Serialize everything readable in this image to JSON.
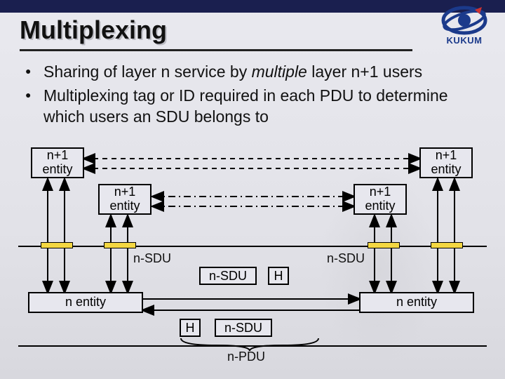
{
  "header": {
    "title": "Multiplexing",
    "logo_text": "KUKUM"
  },
  "bullets": [
    "Sharing of layer n service by multiple layer n+1 users",
    "Multiplexing tag or ID required in each PDU to determine which users an SDU belongs to"
  ],
  "diagram": {
    "entities": {
      "upper_left_1": "n+1\nentity",
      "upper_left_2": "n+1\nentity",
      "upper_right_1": "n+1\nentity",
      "upper_right_2": "n+1\nentity",
      "lower_left": "n entity",
      "lower_right": "n entity"
    },
    "labels": {
      "sdu_left": "n-SDU",
      "sdu_mid": "n-SDU",
      "sdu_right": "n-SDU",
      "header_right": "H",
      "header_left": "H",
      "sdu_bottom": "n-SDU",
      "pdu": "n-PDU"
    }
  },
  "chart_data": {
    "type": "diagram",
    "title": "Multiplexing",
    "description": "Two pairs of n+1 entities on each side multiplex their SDUs via a single n entity on each side, which exchanges an n-PDU composed of a header (H) plus an n-SDU.",
    "nodes": [
      {
        "id": "ul1",
        "label": "n+1 entity",
        "layer": "n+1",
        "side": "left"
      },
      {
        "id": "ul2",
        "label": "n+1 entity",
        "layer": "n+1",
        "side": "left"
      },
      {
        "id": "ur1",
        "label": "n+1 entity",
        "layer": "n+1",
        "side": "right"
      },
      {
        "id": "ur2",
        "label": "n+1 entity",
        "layer": "n+1",
        "side": "right"
      },
      {
        "id": "ll",
        "label": "n entity",
        "layer": "n",
        "side": "left"
      },
      {
        "id": "lr",
        "label": "n entity",
        "layer": "n",
        "side": "right"
      }
    ],
    "edges": [
      {
        "from": "ul1",
        "to": "ur1",
        "style": "dashed",
        "meaning": "peer n+1 communication"
      },
      {
        "from": "ul2",
        "to": "ur2",
        "style": "dash-dot",
        "meaning": "peer n+1 communication"
      },
      {
        "from": "ul1",
        "to": "ll",
        "style": "solid",
        "meaning": "n-SDU down"
      },
      {
        "from": "ul2",
        "to": "ll",
        "style": "solid",
        "meaning": "n-SDU down"
      },
      {
        "from": "ur1",
        "to": "lr",
        "style": "solid",
        "meaning": "n-SDU down"
      },
      {
        "from": "ur2",
        "to": "lr",
        "style": "solid",
        "meaning": "n-SDU down"
      },
      {
        "from": "ll",
        "to": "lr",
        "style": "solid",
        "meaning": "n-PDU = H + n-SDU"
      }
    ]
  }
}
